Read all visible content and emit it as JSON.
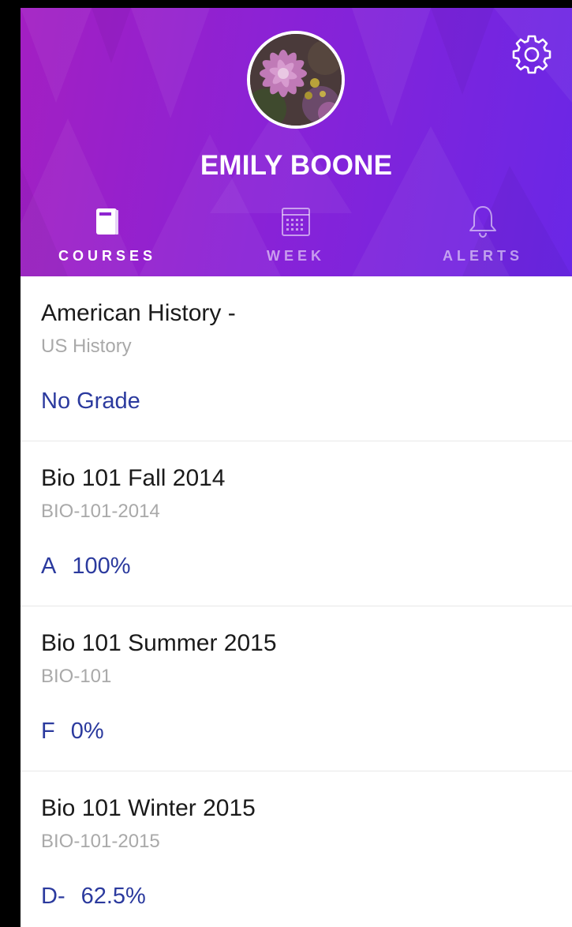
{
  "profile": {
    "name": "EMILY BOONE",
    "avatar_description": "flower-photo"
  },
  "header": {
    "settings_icon": "gear-icon",
    "gradient_start": "#a31fc2",
    "gradient_end": "#6a27e6"
  },
  "tabs": [
    {
      "label": "COURSES",
      "icon": "book-icon",
      "active": true
    },
    {
      "label": "WEEK",
      "icon": "calendar-icon",
      "active": false
    },
    {
      "label": "ALERTS",
      "icon": "bell-icon",
      "active": false
    }
  ],
  "courses": [
    {
      "title": "American History -",
      "code": "US History",
      "grade_letter": "",
      "grade_value": "No Grade"
    },
    {
      "title": "Bio 101 Fall 2014",
      "code": "BIO-101-2014",
      "grade_letter": "A",
      "grade_value": "100%"
    },
    {
      "title": "Bio 101 Summer 2015",
      "code": "BIO-101",
      "grade_letter": "F",
      "grade_value": "0%"
    },
    {
      "title": "Bio 101 Winter 2015",
      "code": "BIO-101-2015",
      "grade_letter": "D-",
      "grade_value": "62.5%"
    }
  ],
  "colors": {
    "grade_text": "#2b3a9e",
    "course_code_text": "#a9a9a9"
  }
}
